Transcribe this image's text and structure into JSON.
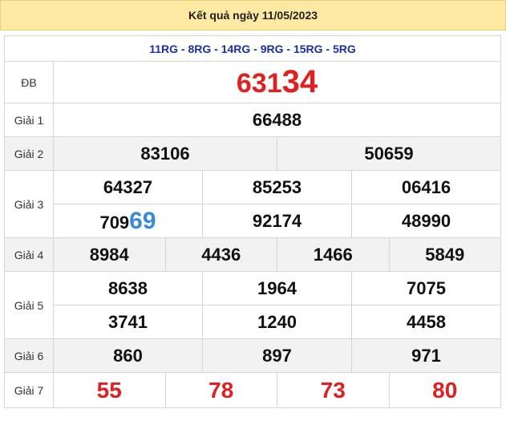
{
  "header": {
    "title": "Kết quả ngày 11/05/2023"
  },
  "codes": "11RG - 8RG - 14RG - 9RG - 15RG - 5RG",
  "db": {
    "label": "ĐB",
    "prefix": "631",
    "suffix": "34"
  },
  "giai1": {
    "label": "Giải 1",
    "values": [
      "66488"
    ]
  },
  "giai2": {
    "label": "Giải 2",
    "values": [
      "83106",
      "50659"
    ]
  },
  "giai3": {
    "label": "Giải 3",
    "row1": [
      "64327",
      "85253",
      "06416"
    ],
    "row2": [
      {
        "prefix": "709",
        "suffix": "69"
      },
      "92174",
      "48990"
    ]
  },
  "giai4": {
    "label": "Giải 4",
    "values": [
      "8984",
      "4436",
      "1466",
      "5849"
    ]
  },
  "giai5": {
    "label": "Giải 5",
    "row1": [
      "8638",
      "1964",
      "7075"
    ],
    "row2": [
      "3741",
      "1240",
      "4458"
    ]
  },
  "giai6": {
    "label": "Giải 6",
    "values": [
      "860",
      "897",
      "971"
    ]
  },
  "giai7": {
    "label": "Giải 7",
    "values": [
      "55",
      "78",
      "73",
      "80"
    ]
  },
  "colors": {
    "header_bg": "#fde9a2",
    "red": "#e02020",
    "blue": "#3a8ad8",
    "code": "#1a2fa0",
    "row_gray": "#f2f2f2"
  }
}
